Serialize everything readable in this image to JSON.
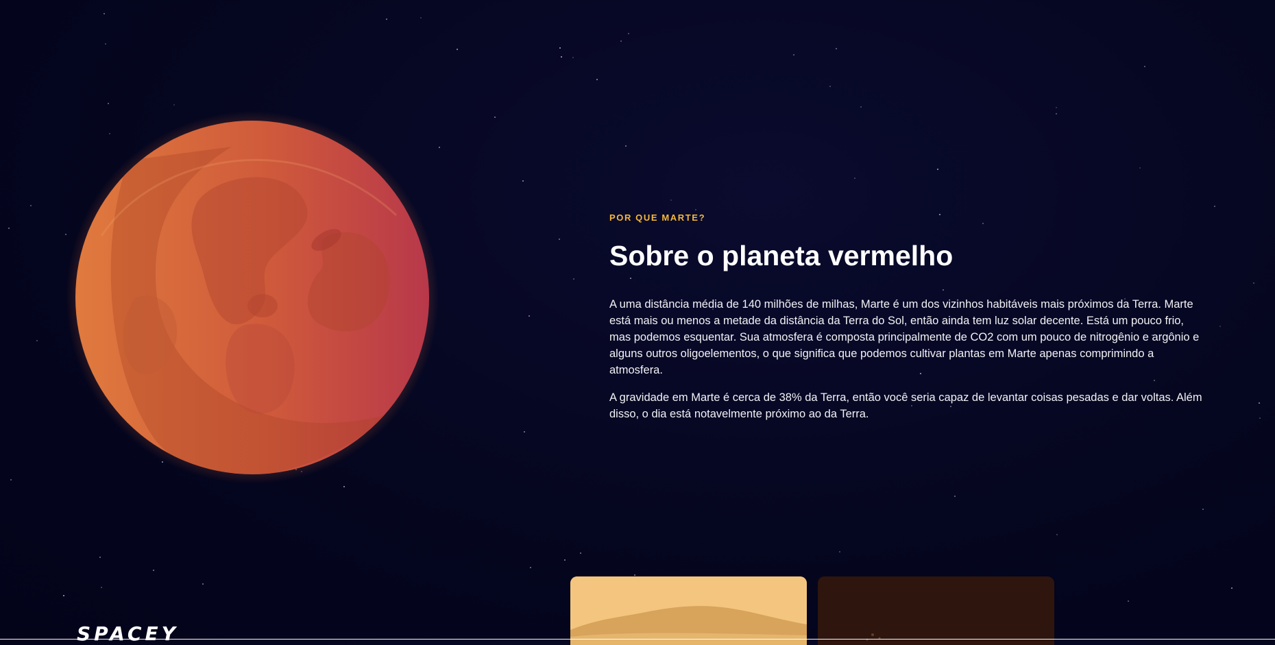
{
  "section": {
    "kicker": "POR QUE MARTE?",
    "title": "Sobre o planeta vermelho",
    "paragraphs": [
      "A uma distância média de 140 milhões de milhas, Marte é um dos vizinhos habitáveis mais próximos da Terra. Marte está mais ou menos a metade da distância da Terra do Sol, então ainda tem luz solar decente. Está um pouco frio, mas podemos esquentar. Sua atmosfera é composta principalmente de CO2 com um pouco de nitrogênio e argônio e alguns outros oligoelementos, o que significa que podemos cultivar plantas em Marte apenas comprimindo a atmosfera.",
      "A gravidade em Marte é cerca de 38% da Terra, então você seria capaz de levantar coisas pesadas e dar voltas. Além disso, o dia está notavelmente próximo ao da Terra."
    ]
  },
  "logo": {
    "text": "SPACEY"
  },
  "colors": {
    "background": "#05061f",
    "accent": "#f5b83a",
    "planet": "#d9583a"
  },
  "icons": {
    "planet": "mars-planet-illustration",
    "cards": [
      "mars-mountain-landscape-image",
      "mars-dust-storm-image"
    ]
  }
}
